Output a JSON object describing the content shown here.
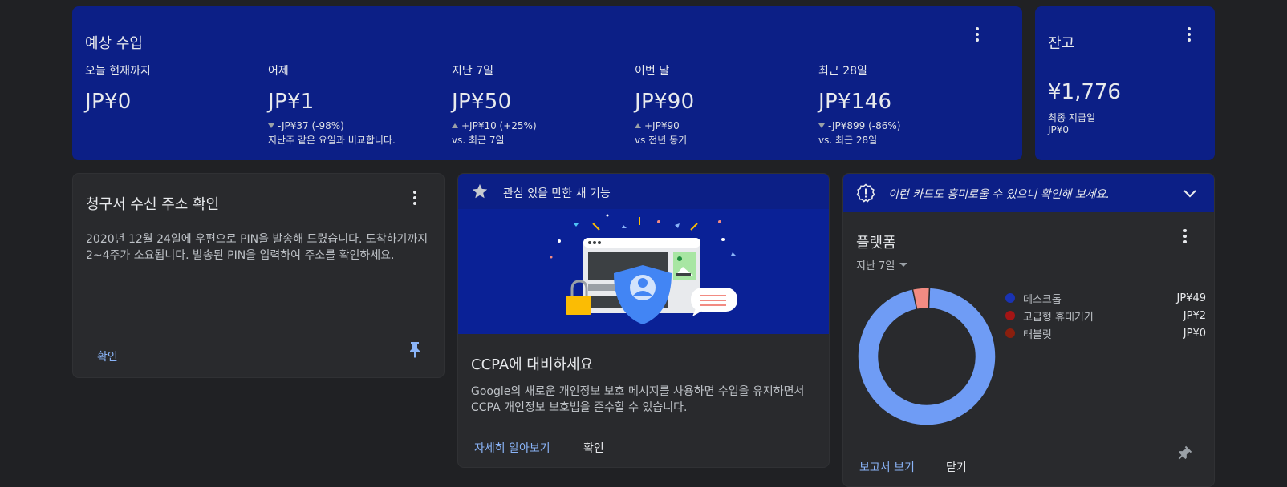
{
  "colors": {
    "background": "#202124",
    "blue_card": "#0c1f86",
    "dark_card": "#292a2d",
    "link": "#8ab4f8"
  },
  "earnings": {
    "title": "예상 수입",
    "metrics": [
      {
        "label": "오늘 현재까지",
        "value": "JP¥0",
        "delta": "",
        "compare": "",
        "trend": "none"
      },
      {
        "label": "어제",
        "value": "JP¥1",
        "delta": "-JP¥37 (-98%)",
        "compare": "지난주 같은 요일과 비교합니다.",
        "trend": "down"
      },
      {
        "label": "지난 7일",
        "value": "JP¥50",
        "delta": "+JP¥10 (+25%)",
        "compare": "vs. 최근 7일",
        "trend": "up"
      },
      {
        "label": "이번 달",
        "value": "JP¥90",
        "delta": "+JP¥90",
        "compare": "vs 전년 동기",
        "trend": "up"
      },
      {
        "label": "최근 28일",
        "value": "JP¥146",
        "delta": "-JP¥899 (-86%)",
        "compare": "vs. 최근 28일",
        "trend": "down"
      }
    ]
  },
  "balance": {
    "title": "잔고",
    "value": "¥1,776",
    "last_payment_label": "최종 지급일",
    "last_payment_value": "JP¥0"
  },
  "address": {
    "title": "청구서 수신 주소 확인",
    "body": "2020년 12월 24일에 우편으로 PIN을 발송해 드렸습니다. 도착하기까지 2~4주가 소요됩니다. 발송된 PIN을 입력하여 주소를 확인하세요.",
    "action": "확인"
  },
  "features": {
    "header": "관심 있을 만한 새 기능",
    "title": "CCPA에 대비하세요",
    "body": "Google의 새로운 개인정보 보호 메시지를 사용하면 수입을 유지하면서 CCPA 개인정보 보호법을 준수할 수 있습니다.",
    "learn_more": "자세히 알아보기",
    "confirm": "확인"
  },
  "platform": {
    "header": "이런 카드도 흥미로울 수 있으니 확인해 보세요.",
    "title": "플랫폼",
    "range": "지난 7일",
    "view_report": "보고서 보기",
    "close": "닫기",
    "items": [
      {
        "name": "데스크톱",
        "value": "JP¥49",
        "amount": 49,
        "color": "#1a33b3",
        "ring_color": "#6f9cf5"
      },
      {
        "name": "고급형 휴대기기",
        "value": "JP¥2",
        "amount": 2,
        "color": "#a31515",
        "ring_color": "#f28b82"
      },
      {
        "name": "태블릿",
        "value": "JP¥0",
        "amount": 0,
        "color": "#8a1f0e",
        "ring_color": "#8a1f0e"
      }
    ]
  }
}
